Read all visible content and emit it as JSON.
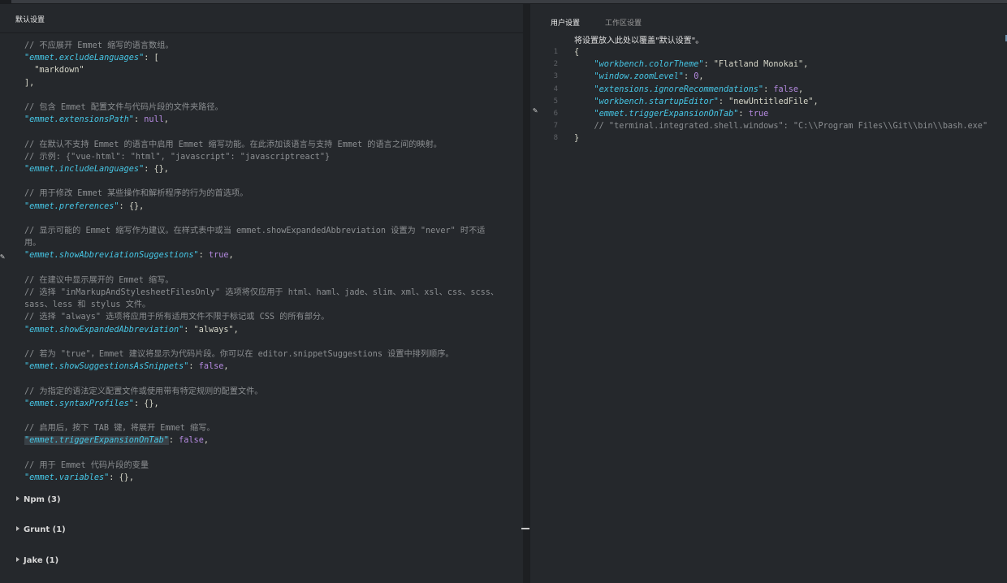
{
  "left": {
    "title": "默认设置",
    "code_lines": [
      [
        {
          "t": "// 不应展开 Emmet 缩写的语言数组。",
          "c": "comment"
        }
      ],
      [
        {
          "t": "\"emmet.excludeLanguages\"",
          "c": "key"
        },
        {
          "t": ": [",
          "c": "punc"
        }
      ],
      [
        {
          "t": "  \"markdown\"",
          "c": "str"
        }
      ],
      [
        {
          "t": "],",
          "c": "punc"
        }
      ],
      [],
      [
        {
          "t": "// 包含 Emmet 配置文件与代码片段的文件夹路径。",
          "c": "comment"
        }
      ],
      [
        {
          "t": "\"emmet.extensionsPath\"",
          "c": "key"
        },
        {
          "t": ": ",
          "c": "punc"
        },
        {
          "t": "null",
          "c": "kw"
        },
        {
          "t": ",",
          "c": "punc"
        }
      ],
      [],
      [
        {
          "t": "// 在默认不支持 Emmet 的语言中启用 Emmet 缩写功能。在此添加该语言与支持 Emmet 的语言之间的映射。",
          "c": "comment"
        }
      ],
      [
        {
          "t": "// 示例: {\"vue-html\": \"html\", \"javascript\": \"javascriptreact\"}",
          "c": "comment"
        }
      ],
      [
        {
          "t": "\"emmet.includeLanguages\"",
          "c": "key"
        },
        {
          "t": ": {},",
          "c": "punc"
        }
      ],
      [],
      [
        {
          "t": "// 用于修改 Emmet 某些操作和解析程序的行为的首选项。",
          "c": "comment"
        }
      ],
      [
        {
          "t": "\"emmet.preferences\"",
          "c": "key"
        },
        {
          "t": ": {},",
          "c": "punc"
        }
      ],
      [],
      [
        {
          "t": "// 显示可能的 Emmet 缩写作为建议。在样式表中或当 emmet.showExpandedAbbreviation 设置为 \"never\" 时不适",
          "c": "comment"
        }
      ],
      [
        {
          "t": "用。",
          "c": "comment"
        }
      ],
      [
        {
          "t": "\"emmet.showAbbreviationSuggestions\"",
          "c": "key"
        },
        {
          "t": ": ",
          "c": "punc"
        },
        {
          "t": "true",
          "c": "kw"
        },
        {
          "t": ",",
          "c": "punc"
        }
      ],
      [],
      [
        {
          "t": "// 在建议中显示展开的 Emmet 缩写。",
          "c": "comment"
        }
      ],
      [
        {
          "t": "// 选择 \"inMarkupAndStylesheetFilesOnly\" 选项将仅应用于 html、haml、jade、slim、xml、xsl、css、scss、",
          "c": "comment"
        }
      ],
      [
        {
          "t": "sass、less 和 stylus 文件。",
          "c": "comment"
        }
      ],
      [
        {
          "t": "// 选择 \"always\" 选项将应用于所有适用文件不限于标记或 CSS 的所有部分。",
          "c": "comment"
        }
      ],
      [
        {
          "t": "\"emmet.showExpandedAbbreviation\"",
          "c": "key"
        },
        {
          "t": ": ",
          "c": "punc"
        },
        {
          "t": "\"always\"",
          "c": "str"
        },
        {
          "t": ",",
          "c": "punc"
        }
      ],
      [],
      [
        {
          "t": "// 若为 \"true\"，Emmet 建议将显示为代码片段。你可以在 editor.snippetSuggestions 设置中排列顺序。",
          "c": "comment"
        }
      ],
      [
        {
          "t": "\"emmet.showSuggestionsAsSnippets\"",
          "c": "key"
        },
        {
          "t": ": ",
          "c": "punc"
        },
        {
          "t": "false",
          "c": "kw"
        },
        {
          "t": ",",
          "c": "punc"
        }
      ],
      [],
      [
        {
          "t": "// 为指定的语法定义配置文件或使用带有特定规则的配置文件。",
          "c": "comment"
        }
      ],
      [
        {
          "t": "\"emmet.syntaxProfiles\"",
          "c": "key"
        },
        {
          "t": ": {},",
          "c": "punc"
        }
      ],
      [],
      [
        {
          "t": "// 启用后，按下 TAB 键，将展开 Emmet 缩写。",
          "c": "comment"
        }
      ],
      [
        {
          "t": "\"emmet.triggerExpansionOnTab\"",
          "c": "key",
          "hl": true
        },
        {
          "t": ": ",
          "c": "punc"
        },
        {
          "t": "false",
          "c": "kw"
        },
        {
          "t": ",",
          "c": "punc"
        }
      ],
      [],
      [
        {
          "t": "// 用于 Emmet 代码片段的变量",
          "c": "comment"
        }
      ],
      [
        {
          "t": "\"emmet.variables\"",
          "c": "key"
        },
        {
          "t": ": {},",
          "c": "punc"
        }
      ]
    ],
    "sections": [
      "Npm (3)",
      "Grunt (1)",
      "Jake (1)"
    ]
  },
  "right": {
    "tabs": [
      "用户设置",
      "工作区设置"
    ],
    "hint": "将设置放入此处以覆盖\"默认设置\"。",
    "line_numbers": [
      "1",
      "2",
      "3",
      "4",
      "5",
      "6",
      "7",
      "8"
    ],
    "code_lines": [
      [
        {
          "t": "{",
          "c": "punc"
        }
      ],
      [
        {
          "t": "    \"workbench.colorTheme\"",
          "c": "key"
        },
        {
          "t": ": ",
          "c": "punc"
        },
        {
          "t": "\"Flatland Monokai\"",
          "c": "str"
        },
        {
          "t": ",",
          "c": "punc"
        }
      ],
      [
        {
          "t": "    \"window.zoomLevel\"",
          "c": "key"
        },
        {
          "t": ": ",
          "c": "punc"
        },
        {
          "t": "0",
          "c": "kw"
        },
        {
          "t": ",",
          "c": "punc"
        }
      ],
      [
        {
          "t": "    \"extensions.ignoreRecommendations\"",
          "c": "key"
        },
        {
          "t": ": ",
          "c": "punc"
        },
        {
          "t": "false",
          "c": "kw"
        },
        {
          "t": ",",
          "c": "punc"
        }
      ],
      [
        {
          "t": "    \"workbench.startupEditor\"",
          "c": "key"
        },
        {
          "t": ": ",
          "c": "punc"
        },
        {
          "t": "\"newUntitledFile\"",
          "c": "str"
        },
        {
          "t": ",",
          "c": "punc"
        }
      ],
      [
        {
          "t": "    \"emmet.triggerExpansionOnTab\"",
          "c": "key"
        },
        {
          "t": ": ",
          "c": "punc"
        },
        {
          "t": "true",
          "c": "kw"
        }
      ],
      [
        {
          "t": "    // \"terminal.integrated.shell.windows\": \"C:\\\\Program Files\\\\Git\\\\bin\\\\bash.exe\"",
          "c": "comment"
        }
      ],
      [
        {
          "t": "}",
          "c": "punc"
        }
      ]
    ]
  },
  "icons": {
    "edit_left": "pencil-icon",
    "edit_right": "pencil-icon",
    "section": "triangle-right-icon"
  },
  "colors": {
    "background": "#25282c",
    "key": "#46c7e6",
    "keyword": "#b58ae0",
    "comment": "#8b8e91",
    "text": "#d6d6c8"
  }
}
